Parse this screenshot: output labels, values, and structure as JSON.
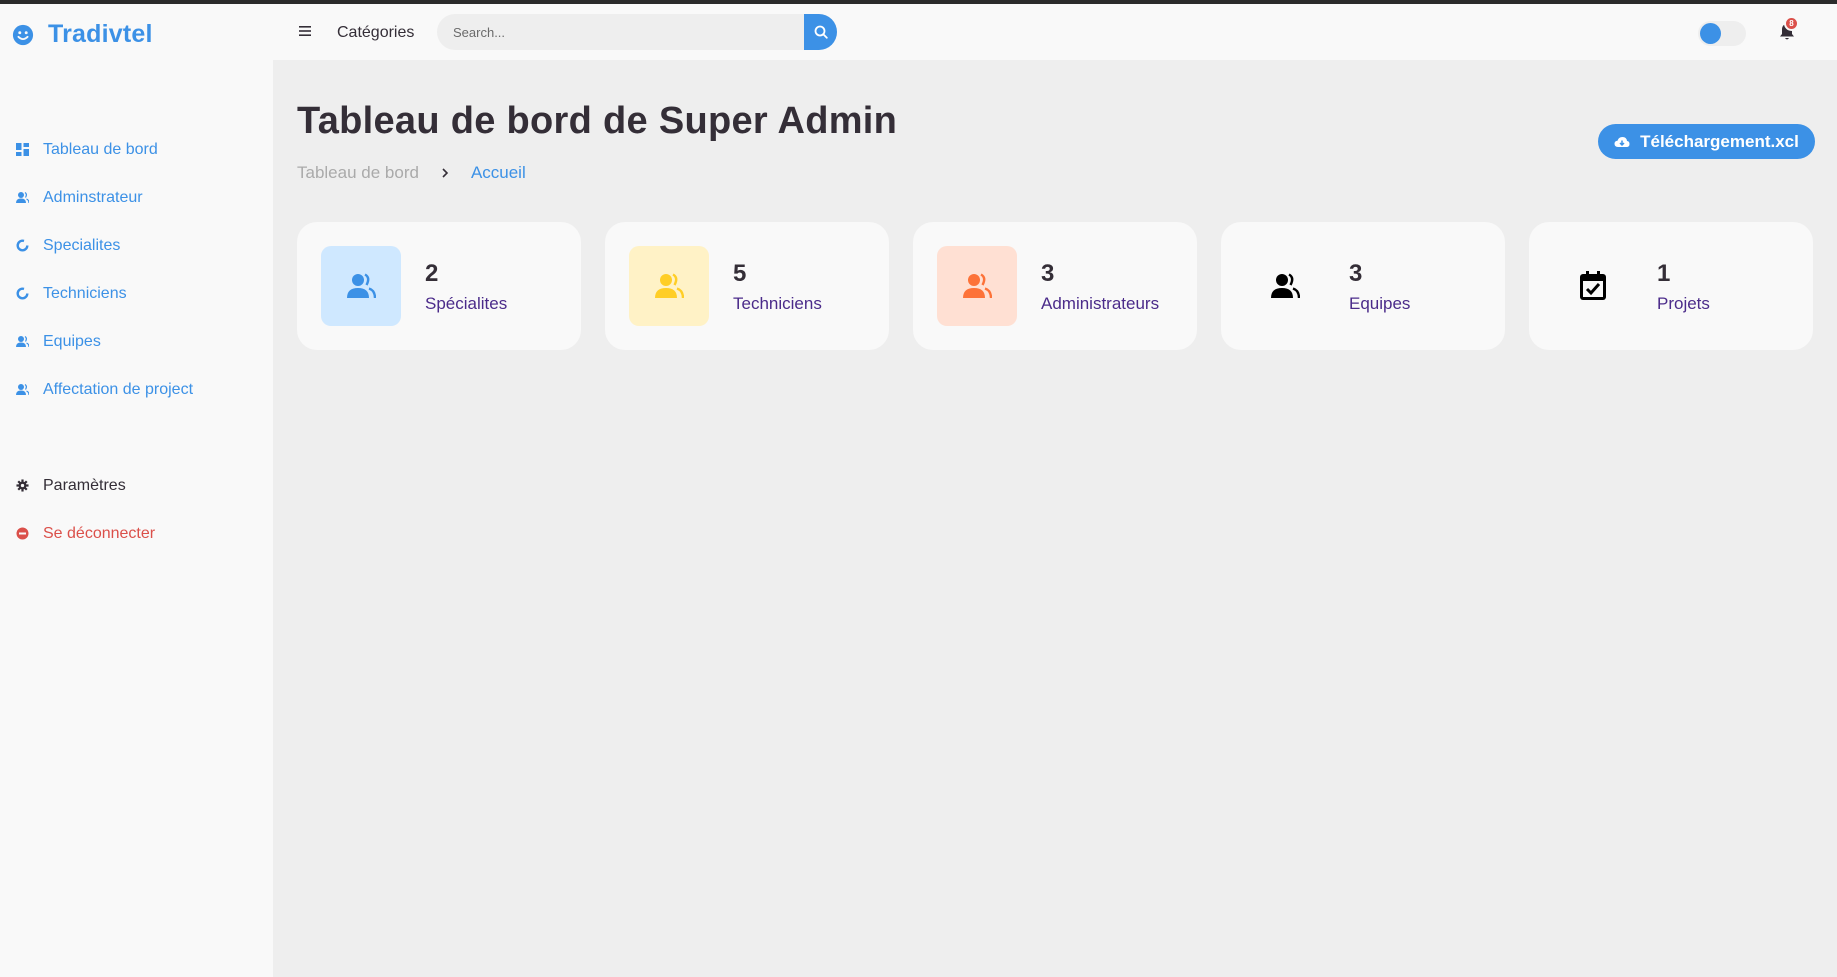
{
  "app": {
    "brand": "Tradivtel"
  },
  "header": {
    "categories_label": "Catégories",
    "search_placeholder": "Search...",
    "notification_count": "8"
  },
  "sidebar": {
    "items": [
      {
        "label": "Tableau de bord",
        "icon": "dashboard-icon"
      },
      {
        "label": "Adminstrateur",
        "icon": "users-icon"
      },
      {
        "label": "Specialites",
        "icon": "donut-icon"
      },
      {
        "label": "Techniciens",
        "icon": "donut-icon"
      },
      {
        "label": "Equipes",
        "icon": "users-icon"
      },
      {
        "label": "Affectation de project",
        "icon": "users-icon"
      }
    ],
    "settings_label": "Paramètres",
    "logout_label": "Se déconnecter"
  },
  "main": {
    "title": "Tableau de bord de Super Admin",
    "breadcrumb": [
      "Tableau de bord",
      "Accueil"
    ],
    "download_label": "Téléchargement.xcl",
    "cards": [
      {
        "value": "2",
        "label": "Spécialites",
        "icon": "users-icon",
        "bg": "#cfe8ff",
        "color": "#3c91e6"
      },
      {
        "value": "5",
        "label": "Techniciens",
        "icon": "users-icon",
        "bg": "#fff2c6",
        "color": "#ffce26"
      },
      {
        "value": "3",
        "label": "Administrateurs",
        "icon": "users-icon",
        "bg": "#ffe0d3",
        "color": "#fd7238"
      },
      {
        "value": "3",
        "label": "Equipes",
        "icon": "users-icon",
        "bg": "#f9f9f9",
        "color": "#000000"
      },
      {
        "value": "1",
        "label": "Projets",
        "icon": "calendar-check-icon",
        "bg": "#f9f9f9",
        "color": "#000000"
      }
    ]
  },
  "colors": {
    "accent": "#3c91e6",
    "danger": "#db504a",
    "text": "#342e37",
    "label": "#4b2b8a"
  }
}
